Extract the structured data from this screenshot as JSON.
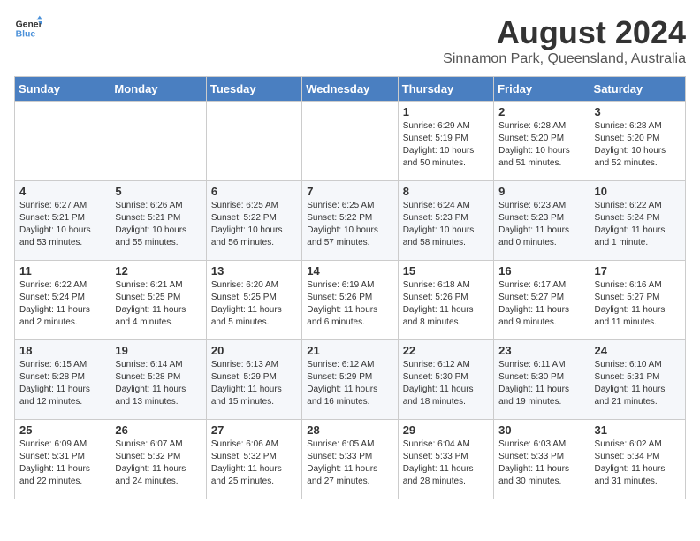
{
  "logo": {
    "line1": "General",
    "line2": "Blue"
  },
  "title": "August 2024",
  "subtitle": "Sinnamon Park, Queensland, Australia",
  "headers": [
    "Sunday",
    "Monday",
    "Tuesday",
    "Wednesday",
    "Thursday",
    "Friday",
    "Saturday"
  ],
  "weeks": [
    [
      {
        "day": "",
        "info": ""
      },
      {
        "day": "",
        "info": ""
      },
      {
        "day": "",
        "info": ""
      },
      {
        "day": "",
        "info": ""
      },
      {
        "day": "1",
        "info": "Sunrise: 6:29 AM\nSunset: 5:19 PM\nDaylight: 10 hours\nand 50 minutes."
      },
      {
        "day": "2",
        "info": "Sunrise: 6:28 AM\nSunset: 5:20 PM\nDaylight: 10 hours\nand 51 minutes."
      },
      {
        "day": "3",
        "info": "Sunrise: 6:28 AM\nSunset: 5:20 PM\nDaylight: 10 hours\nand 52 minutes."
      }
    ],
    [
      {
        "day": "4",
        "info": "Sunrise: 6:27 AM\nSunset: 5:21 PM\nDaylight: 10 hours\nand 53 minutes."
      },
      {
        "day": "5",
        "info": "Sunrise: 6:26 AM\nSunset: 5:21 PM\nDaylight: 10 hours\nand 55 minutes."
      },
      {
        "day": "6",
        "info": "Sunrise: 6:25 AM\nSunset: 5:22 PM\nDaylight: 10 hours\nand 56 minutes."
      },
      {
        "day": "7",
        "info": "Sunrise: 6:25 AM\nSunset: 5:22 PM\nDaylight: 10 hours\nand 57 minutes."
      },
      {
        "day": "8",
        "info": "Sunrise: 6:24 AM\nSunset: 5:23 PM\nDaylight: 10 hours\nand 58 minutes."
      },
      {
        "day": "9",
        "info": "Sunrise: 6:23 AM\nSunset: 5:23 PM\nDaylight: 11 hours\nand 0 minutes."
      },
      {
        "day": "10",
        "info": "Sunrise: 6:22 AM\nSunset: 5:24 PM\nDaylight: 11 hours\nand 1 minute."
      }
    ],
    [
      {
        "day": "11",
        "info": "Sunrise: 6:22 AM\nSunset: 5:24 PM\nDaylight: 11 hours\nand 2 minutes."
      },
      {
        "day": "12",
        "info": "Sunrise: 6:21 AM\nSunset: 5:25 PM\nDaylight: 11 hours\nand 4 minutes."
      },
      {
        "day": "13",
        "info": "Sunrise: 6:20 AM\nSunset: 5:25 PM\nDaylight: 11 hours\nand 5 minutes."
      },
      {
        "day": "14",
        "info": "Sunrise: 6:19 AM\nSunset: 5:26 PM\nDaylight: 11 hours\nand 6 minutes."
      },
      {
        "day": "15",
        "info": "Sunrise: 6:18 AM\nSunset: 5:26 PM\nDaylight: 11 hours\nand 8 minutes."
      },
      {
        "day": "16",
        "info": "Sunrise: 6:17 AM\nSunset: 5:27 PM\nDaylight: 11 hours\nand 9 minutes."
      },
      {
        "day": "17",
        "info": "Sunrise: 6:16 AM\nSunset: 5:27 PM\nDaylight: 11 hours\nand 11 minutes."
      }
    ],
    [
      {
        "day": "18",
        "info": "Sunrise: 6:15 AM\nSunset: 5:28 PM\nDaylight: 11 hours\nand 12 minutes."
      },
      {
        "day": "19",
        "info": "Sunrise: 6:14 AM\nSunset: 5:28 PM\nDaylight: 11 hours\nand 13 minutes."
      },
      {
        "day": "20",
        "info": "Sunrise: 6:13 AM\nSunset: 5:29 PM\nDaylight: 11 hours\nand 15 minutes."
      },
      {
        "day": "21",
        "info": "Sunrise: 6:12 AM\nSunset: 5:29 PM\nDaylight: 11 hours\nand 16 minutes."
      },
      {
        "day": "22",
        "info": "Sunrise: 6:12 AM\nSunset: 5:30 PM\nDaylight: 11 hours\nand 18 minutes."
      },
      {
        "day": "23",
        "info": "Sunrise: 6:11 AM\nSunset: 5:30 PM\nDaylight: 11 hours\nand 19 minutes."
      },
      {
        "day": "24",
        "info": "Sunrise: 6:10 AM\nSunset: 5:31 PM\nDaylight: 11 hours\nand 21 minutes."
      }
    ],
    [
      {
        "day": "25",
        "info": "Sunrise: 6:09 AM\nSunset: 5:31 PM\nDaylight: 11 hours\nand 22 minutes."
      },
      {
        "day": "26",
        "info": "Sunrise: 6:07 AM\nSunset: 5:32 PM\nDaylight: 11 hours\nand 24 minutes."
      },
      {
        "day": "27",
        "info": "Sunrise: 6:06 AM\nSunset: 5:32 PM\nDaylight: 11 hours\nand 25 minutes."
      },
      {
        "day": "28",
        "info": "Sunrise: 6:05 AM\nSunset: 5:33 PM\nDaylight: 11 hours\nand 27 minutes."
      },
      {
        "day": "29",
        "info": "Sunrise: 6:04 AM\nSunset: 5:33 PM\nDaylight: 11 hours\nand 28 minutes."
      },
      {
        "day": "30",
        "info": "Sunrise: 6:03 AM\nSunset: 5:33 PM\nDaylight: 11 hours\nand 30 minutes."
      },
      {
        "day": "31",
        "info": "Sunrise: 6:02 AM\nSunset: 5:34 PM\nDaylight: 11 hours\nand 31 minutes."
      }
    ]
  ]
}
